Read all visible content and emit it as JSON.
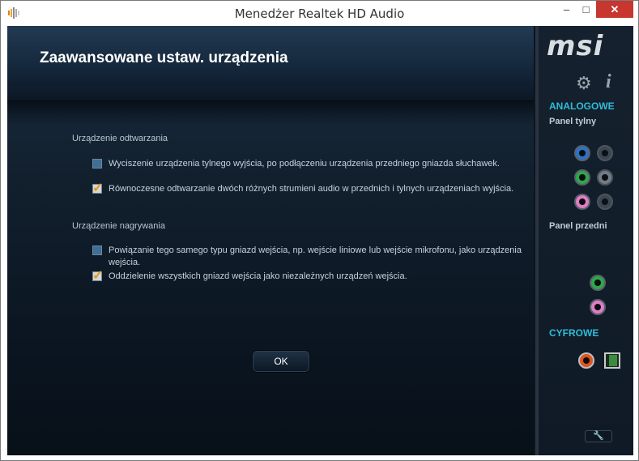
{
  "window": {
    "title": "Menedżer Realtek HD Audio",
    "controls": {
      "minimize": "–",
      "maximize": "□",
      "close": "✕"
    }
  },
  "page": {
    "title": "Zaawansowane ustaw. urządzenia",
    "playback": {
      "label": "Urządzenie odtwarzania",
      "options": [
        {
          "text": "Wyciszenie urządzenia tylnego wyjścia, po podłączeniu urządzenia przedniego gniazda słuchawek.",
          "checked": false
        },
        {
          "text": "Równoczesne odtwarzanie dwóch różnych strumieni audio w przednich i tylnych urządzeniach wyjścia.",
          "checked": true
        }
      ]
    },
    "recording": {
      "label": "Urządzenie nagrywania",
      "options": [
        {
          "text": "Powiązanie tego samego typu gniazd wejścia, np. wejście liniowe lub wejście mikrofonu, jako urządzenia wejścia.",
          "checked": false
        },
        {
          "text": "Oddzielenie wszystkich gniazd wejścia jako niezależnych urządzeń wejścia.",
          "checked": true
        }
      ]
    },
    "ok_label": "OK"
  },
  "side": {
    "logo": "msi",
    "analog_heading": "ANALOGOWE",
    "rear_panel": "Panel tylny",
    "front_panel": "Panel przedni",
    "digital_heading": "CYFROWE",
    "icons": {
      "settings": "gear-icon",
      "info": "info-icon",
      "tools": "wrench-icon"
    }
  },
  "colors": {
    "accent": "#2fbcd9",
    "close_button": "#c7372f",
    "check_mark": "#e79a12"
  }
}
